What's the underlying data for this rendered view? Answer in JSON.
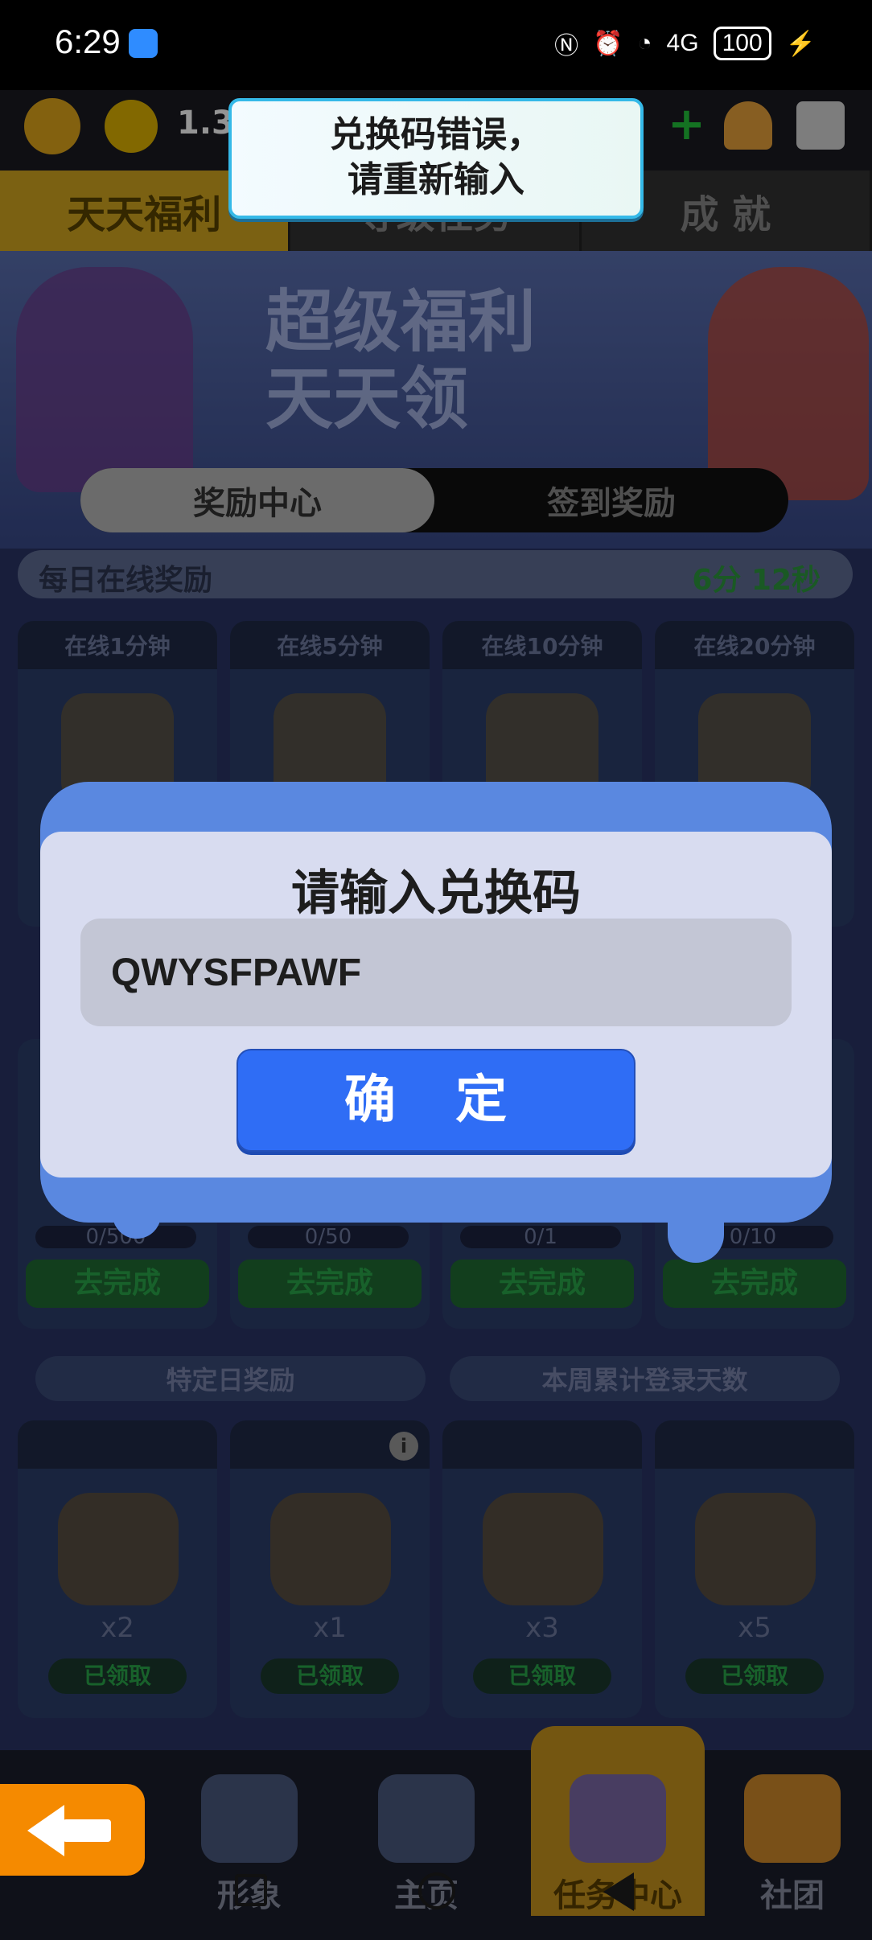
{
  "status_bar": {
    "time": "6:29",
    "network": "4G",
    "battery": "100"
  },
  "top_bar": {
    "coins": "1.3"
  },
  "tabs": [
    {
      "label": "天天福利",
      "active": true
    },
    {
      "label": "等级任务",
      "active": false
    },
    {
      "label": "成 就",
      "active": false
    }
  ],
  "banner": {
    "title_line1": "超级福利",
    "title_line2": "天天领"
  },
  "subtabs": [
    {
      "label": "奖励中心",
      "active": true
    },
    {
      "label": "签到奖励",
      "active": false
    }
  ],
  "online_rewards": {
    "label": "每日在线奖励",
    "timer": "6分 12秒",
    "cards": [
      {
        "label": "在线1分钟"
      },
      {
        "label": "在线5分钟"
      },
      {
        "label": "在线10分钟"
      },
      {
        "label": "在线20分钟"
      }
    ]
  },
  "tasks": [
    {
      "progress": "0/500",
      "button": "去完成"
    },
    {
      "progress": "0/50",
      "button": "去完成"
    },
    {
      "progress": "0/1",
      "button": "去完成"
    },
    {
      "progress": "0/10",
      "button": "去完成"
    }
  ],
  "sections": {
    "special_day": "特定日奖励",
    "weekly_login": "本周累计登录天数"
  },
  "claim_cards": [
    {
      "qty": "x2",
      "status": "已领取"
    },
    {
      "qty": "x1",
      "status": "已领取"
    },
    {
      "qty": "x3",
      "status": "已领取"
    },
    {
      "qty": "x5",
      "status": "已领取"
    }
  ],
  "bottom_nav": [
    {
      "label": "形象"
    },
    {
      "label": "主页"
    },
    {
      "label": "任务中心",
      "active": true
    },
    {
      "label": "社团"
    }
  ],
  "toast": {
    "message": "兑换码错误，\n请重新输入"
  },
  "dialog": {
    "title": "请输入兑换码",
    "input_value": "QWYSFPAWF",
    "confirm_label": "确 定"
  },
  "colors": {
    "dialog_frame": "#5a88e0",
    "confirm_button": "#2f6df5",
    "toast_border": "#35b9e8",
    "active_tab": "#d4a820"
  }
}
